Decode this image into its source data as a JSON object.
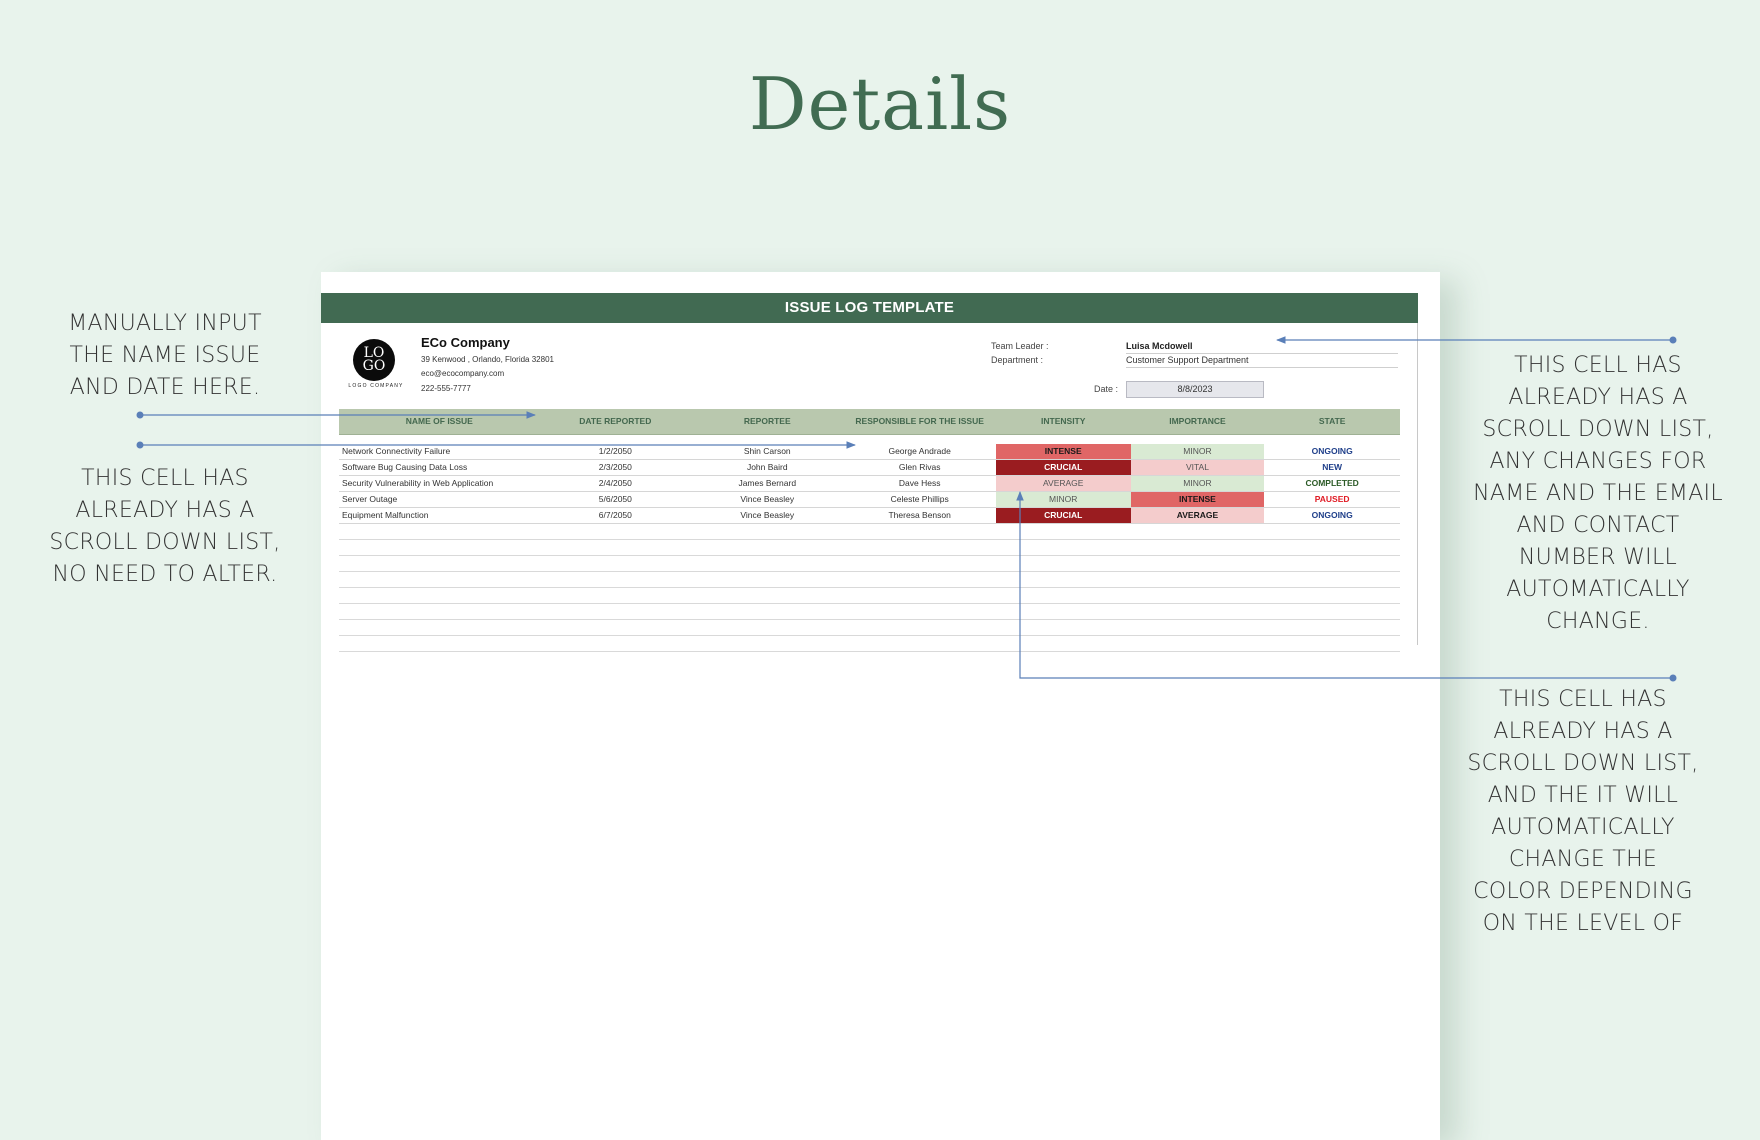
{
  "page_title": "Details",
  "document": {
    "banner_title": "ISSUE LOG TEMPLATE",
    "logo": {
      "text_line1": "LO",
      "text_line2": "GO",
      "caption": "LOGO COMPANY"
    },
    "company": {
      "name": "ECo Company",
      "address": "39 Kenwood , Orlando, Florida 32801",
      "email": "eco@ecocompany.com",
      "phone": "222-555-7777"
    },
    "meta": {
      "team_leader_label": "Team Leader :",
      "team_leader_value": "Luisa Mcdowell",
      "department_label": "Department :",
      "department_value": "Customer  Support Department",
      "date_label": "Date :",
      "date_value": "8/8/2023"
    },
    "table": {
      "columns": [
        "NAME OF ISSUE",
        "DATE REPORTED",
        "REPORTEE",
        "RESPONSIBLE FOR THE ISSUE",
        "INTENSITY",
        "IMPORTANCE",
        "STATE"
      ],
      "rows": [
        {
          "name": "Network Connectivity Failure",
          "date": "1/2/2050",
          "reportee": "Shin Carson",
          "responsible": "George Andrade",
          "intensity": "INTENSE",
          "importance": "MINOR",
          "state": "ONGOING"
        },
        {
          "name": "Software Bug Causing Data Loss",
          "date": "2/3/2050",
          "reportee": "John Baird",
          "responsible": "Glen Rivas",
          "intensity": "CRUCIAL",
          "importance": "VITAL",
          "state": "NEW"
        },
        {
          "name": "Security Vulnerability in Web Application",
          "date": "2/4/2050",
          "reportee": "James Bernard",
          "responsible": "Dave Hess",
          "intensity": "AVERAGE",
          "importance": "MINOR",
          "state": "COMPLETED"
        },
        {
          "name": "Server Outage",
          "date": "5/6/2050",
          "reportee": "Vince Beasley",
          "responsible": "Celeste Phillips",
          "intensity": "MINOR",
          "importance": "INTENSE",
          "state": "PAUSED"
        },
        {
          "name": "Equipment Malfunction",
          "date": "6/7/2050",
          "reportee": "Vince Beasley",
          "responsible": "Theresa Benson",
          "intensity": "CRUCIAL",
          "importance": "AVERAGE",
          "state": "ONGOING"
        }
      ],
      "empty_rows": 8
    },
    "level_styles": {
      "INTENSE": {
        "bg": "#e06666",
        "color": "#1a1a1a",
        "bold": true
      },
      "CRUCIAL": {
        "bg": "#9a1c20",
        "color": "#ffffff",
        "bold": true
      },
      "AVERAGE": {
        "bg": "#f4cccc",
        "color": "#555555",
        "bold": false
      },
      "VITAL": {
        "bg": "#f4cccc",
        "color": "#555555",
        "bold": false
      },
      "MINOR": {
        "bg": "#d9ead3",
        "color": "#555555",
        "bold": false
      }
    },
    "importance_average_bold": true,
    "state_colors": {
      "ONGOING": "#1f3f8a",
      "NEW": "#1f3f8a",
      "COMPLETED": "#2b5a26",
      "PAUSED": "#e01b24"
    }
  },
  "annotations": {
    "left_top": [
      "MANUALLY INPUT",
      "THE NAME ISSUE",
      "AND DATE HERE."
    ],
    "left_bottom": [
      "THIS CELL HAS",
      "ALREADY HAS A",
      "SCROLL DOWN LIST,",
      "NO NEED TO ALTER."
    ],
    "right_top": [
      "THIS CELL HAS",
      "ALREADY HAS A",
      "SCROLL DOWN LIST,",
      "ANY CHANGES FOR",
      "NAME AND THE EMAIL",
      "AND CONTACT",
      "NUMBER WILL",
      "AUTOMATICALLY",
      "CHANGE."
    ],
    "right_bottom": [
      "THIS CELL HAS",
      "ALREADY HAS A",
      "SCROLL DOWN LIST,",
      "AND THE IT WILL",
      "AUTOMATICALLY",
      "CHANGE THE",
      "COLOR DEPENDING",
      "ON THE LEVEL OF"
    ]
  },
  "colors": {
    "accent_green": "#416a52",
    "header_green": "#b9c8ae",
    "callout_blue": "#5a7fb8",
    "background": "#e8f3ec"
  }
}
